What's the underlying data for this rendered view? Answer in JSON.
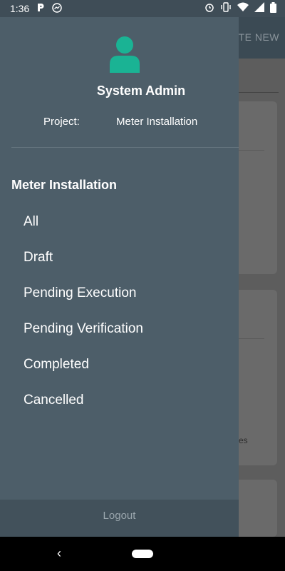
{
  "status_bar": {
    "time": "1:36",
    "left_icons": [
      "parking-icon",
      "messenger-icon"
    ],
    "right_icons": [
      "alarm-icon",
      "vibrate-icon",
      "wifi-icon",
      "signal-icon",
      "battery-icon"
    ]
  },
  "background_app": {
    "create_button_label": "ATE NEW",
    "card_partial_text": "es"
  },
  "drawer": {
    "user": {
      "name": "System Admin",
      "avatar_color": "#1ab394"
    },
    "project": {
      "label": "Project:",
      "value": "Meter Installation"
    },
    "section_title": "Meter Installation",
    "menu": [
      {
        "label": "All"
      },
      {
        "label": "Draft"
      },
      {
        "label": "Pending Execution"
      },
      {
        "label": "Pending Verification"
      },
      {
        "label": "Completed"
      },
      {
        "label": "Cancelled"
      }
    ],
    "logout_label": "Logout"
  },
  "nav_bar": {
    "back_glyph": "‹"
  },
  "colors": {
    "drawer_bg": "#4d5e69",
    "logout_bg": "#42515b",
    "accent": "#1ab394"
  }
}
